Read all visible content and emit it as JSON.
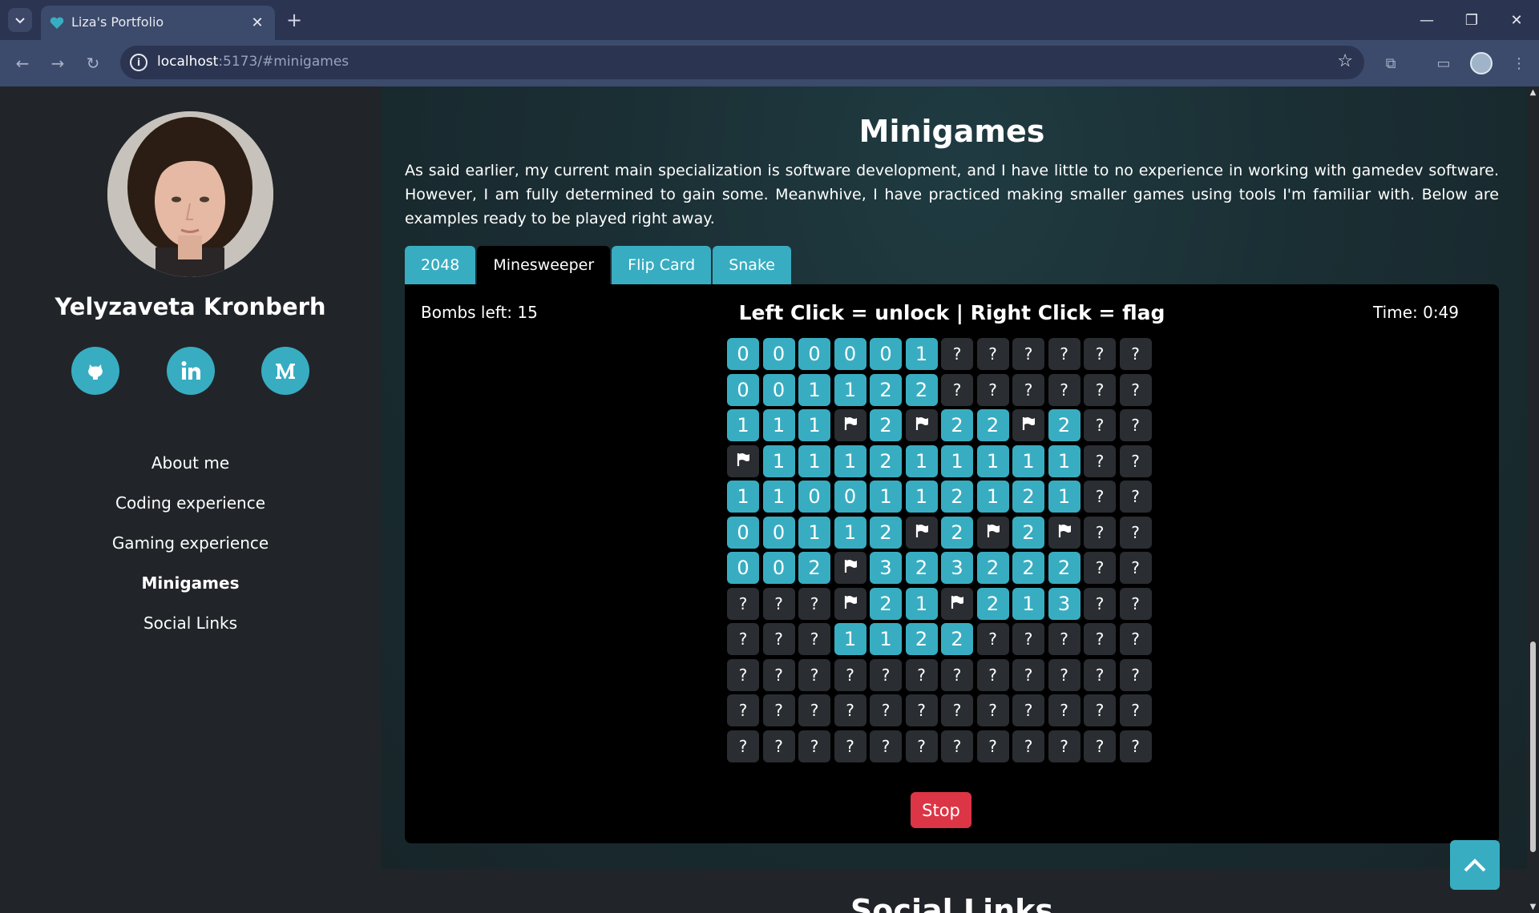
{
  "browser": {
    "tab_title": "Liza's Portfolio",
    "url_host": "localhost",
    "url_path": ":5173/#minigames"
  },
  "sidebar": {
    "name": "Yelyzaveta Kronberh",
    "social": [
      "github-icon",
      "linkedin-icon",
      "medium-icon"
    ],
    "nav": [
      {
        "label": "About me",
        "active": false
      },
      {
        "label": "Coding experience",
        "active": false
      },
      {
        "label": "Gaming experience",
        "active": false
      },
      {
        "label": "Minigames",
        "active": true
      },
      {
        "label": "Social Links",
        "active": false
      }
    ]
  },
  "section": {
    "title": "Minigames",
    "text": "As said earlier, my current main specialization is software development, and I have little to no experience in working with gamedev software. However, I am fully determined to gain some. Meanwhive, I have practiced making smaller games using tools I'm familiar with. Below are examples ready to be played right away.",
    "tabs": [
      {
        "label": "2048",
        "active": false
      },
      {
        "label": "Minesweeper",
        "active": true
      },
      {
        "label": "Flip Card",
        "active": false
      },
      {
        "label": "Snake",
        "active": false
      }
    ]
  },
  "game": {
    "bombs_left": "Bombs left: 15",
    "instructions": "Left Click = unlock | Right Click = flag",
    "time": "Time: 0:49",
    "stop_label": "Stop",
    "board": [
      [
        "0",
        "0",
        "0",
        "0",
        "0",
        "1",
        "?",
        "?",
        "?",
        "?",
        "?",
        "?"
      ],
      [
        "0",
        "0",
        "1",
        "1",
        "2",
        "2",
        "?",
        "?",
        "?",
        "?",
        "?",
        "?"
      ],
      [
        "1",
        "1",
        "1",
        "F",
        "2",
        "F",
        "2",
        "2",
        "F",
        "2",
        "?",
        "?"
      ],
      [
        "F",
        "1",
        "1",
        "1",
        "2",
        "1",
        "1",
        "1",
        "1",
        "1",
        "?",
        "?"
      ],
      [
        "1",
        "1",
        "0",
        "0",
        "1",
        "1",
        "2",
        "1",
        "2",
        "1",
        "?",
        "?"
      ],
      [
        "0",
        "0",
        "1",
        "1",
        "2",
        "F",
        "2",
        "F",
        "2",
        "F",
        "?",
        "?"
      ],
      [
        "0",
        "0",
        "2",
        "F",
        "3",
        "2",
        "3",
        "2",
        "2",
        "2",
        "?",
        "?"
      ],
      [
        "?",
        "?",
        "?",
        "F",
        "2",
        "1",
        "F",
        "2",
        "1",
        "3",
        "?",
        "?"
      ],
      [
        "?",
        "?",
        "?",
        "1",
        "1",
        "2",
        "2",
        "?",
        "?",
        "?",
        "?",
        "?"
      ],
      [
        "?",
        "?",
        "?",
        "?",
        "?",
        "?",
        "?",
        "?",
        "?",
        "?",
        "?",
        "?"
      ],
      [
        "?",
        "?",
        "?",
        "?",
        "?",
        "?",
        "?",
        "?",
        "?",
        "?",
        "?",
        "?"
      ],
      [
        "?",
        "?",
        "?",
        "?",
        "?",
        "?",
        "?",
        "?",
        "?",
        "?",
        "?",
        "?"
      ]
    ]
  },
  "next_section_title": "Social Links",
  "colors": {
    "accent": "#38adc1",
    "danger": "#dc3545",
    "panel": "#000000"
  }
}
